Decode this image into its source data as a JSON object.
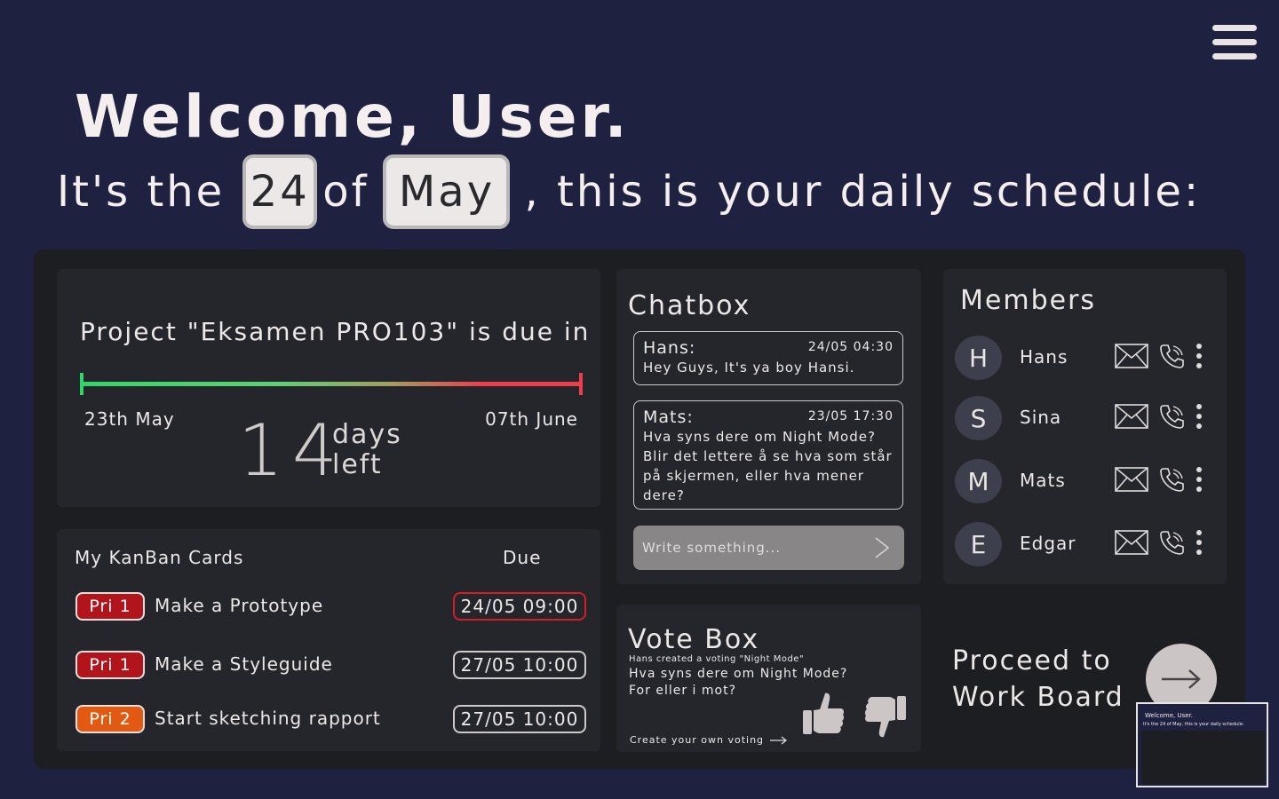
{
  "header": {
    "welcome": "Welcome, User.",
    "line_prefix": "It's the",
    "day": "24",
    "line_of": "of",
    "month": "May",
    "line_suffix": ", this is your daily schedule:"
  },
  "project": {
    "title": "Project \"Eksamen PRO103\" is due in",
    "start_date": "23th May",
    "end_date": "07th June",
    "days_left": "14",
    "days_label_1": "days",
    "days_label_2": "left",
    "progress_fraction": 0.07
  },
  "kanban": {
    "title": "My KanBan Cards",
    "due_label": "Due",
    "cards": [
      {
        "priority": "Pri 1",
        "task": "Make a Prototype",
        "due": "24/05 09:00"
      },
      {
        "priority": "Pri 1",
        "task": "Make a Styleguide",
        "due": "27/05 10:00"
      },
      {
        "priority": "Pri 2",
        "task": "Start sketching rapport",
        "due": "27/05 10:00"
      }
    ]
  },
  "chat": {
    "title": "Chatbox",
    "messages": [
      {
        "name": "Hans:",
        "time": "24/05 04:30",
        "text": "Hey Guys, It's ya boy Hansi."
      },
      {
        "name": "Mats:",
        "time": "23/05 17:30",
        "text": "Hva syns dere om Night Mode? Blir det lettere å se hva som står på skjermen, eller hva mener dere?"
      }
    ],
    "input_placeholder": "Write something..."
  },
  "vote": {
    "title": "Vote Box",
    "meta": "Hans created a voting \"Night Mode\"",
    "question_1": "Hva syns dere om Night Mode?",
    "question_2": "For eller i mot?",
    "create_link": "Create your own voting"
  },
  "members": {
    "title": "Members",
    "list": [
      {
        "initial": "H",
        "name": "Hans"
      },
      {
        "initial": "S",
        "name": "Sina"
      },
      {
        "initial": "M",
        "name": "Mats"
      },
      {
        "initial": "E",
        "name": "Edgar"
      }
    ]
  },
  "proceed": {
    "line_1": "Proceed to",
    "line_2": "Work Board"
  },
  "thumbnail": {
    "welcome": "Welcome, User.",
    "line": "It's the 24 of May, this is your daily schedule:"
  },
  "colors": {
    "background": "#1f2140",
    "panel": "#1d1e22",
    "card": "#25262c",
    "pri1": "#b2141c",
    "pri2": "#e25a12",
    "progress_start": "#32d667",
    "progress_end": "#ee3e4e"
  },
  "icons": [
    "menu-icon",
    "send-icon",
    "thumbs-up-icon",
    "thumbs-down-icon",
    "arrow-right-icon",
    "mail-icon",
    "phone-icon",
    "more-vertical-icon"
  ]
}
